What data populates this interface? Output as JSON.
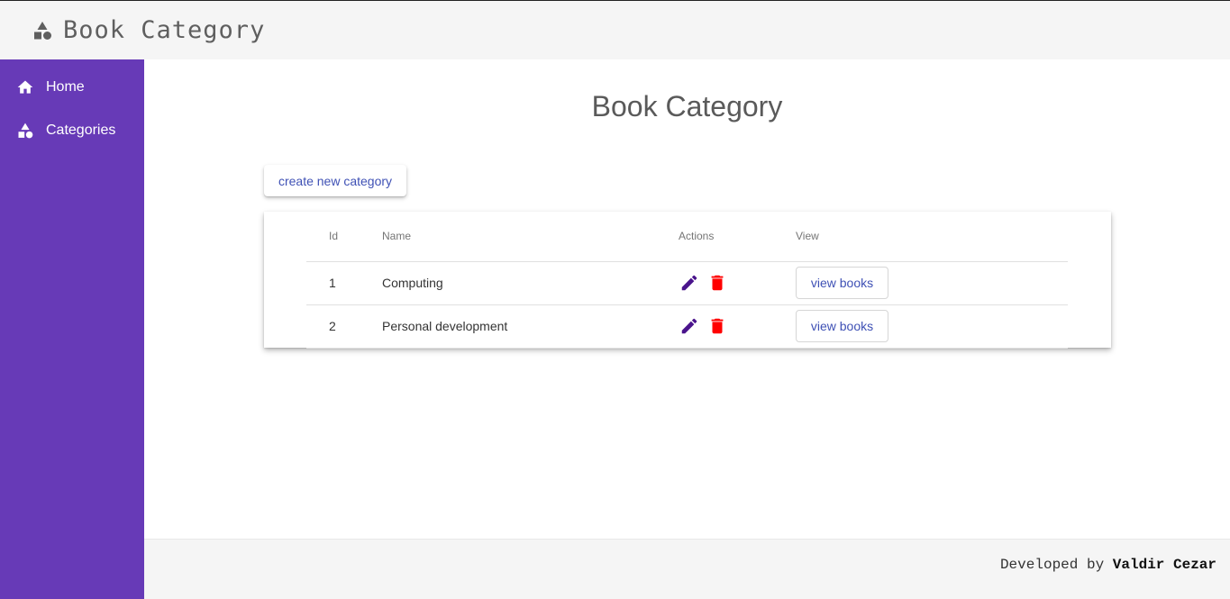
{
  "header": {
    "title": "Book Category",
    "logo_icon": "category-shapes-icon"
  },
  "sidebar": {
    "items": [
      {
        "label": "Home",
        "icon": "home-icon"
      },
      {
        "label": "Categories",
        "icon": "category-shapes-icon"
      }
    ]
  },
  "main": {
    "page_title": "Book Category",
    "create_button_label": "create new category",
    "table": {
      "columns": [
        "Id",
        "Name",
        "Actions",
        "View"
      ],
      "rows": [
        {
          "id": "1",
          "name": "Computing",
          "view_label": "view books"
        },
        {
          "id": "2",
          "name": "Personal development",
          "view_label": "view books"
        }
      ]
    }
  },
  "footer": {
    "prefix": "Developed by",
    "author": "Valdir Cezar"
  },
  "colors": {
    "sidebar": "#673ab7",
    "accent": "#3f51b5",
    "edit_icon": "#4a148c",
    "delete_icon": "#ff0000"
  }
}
